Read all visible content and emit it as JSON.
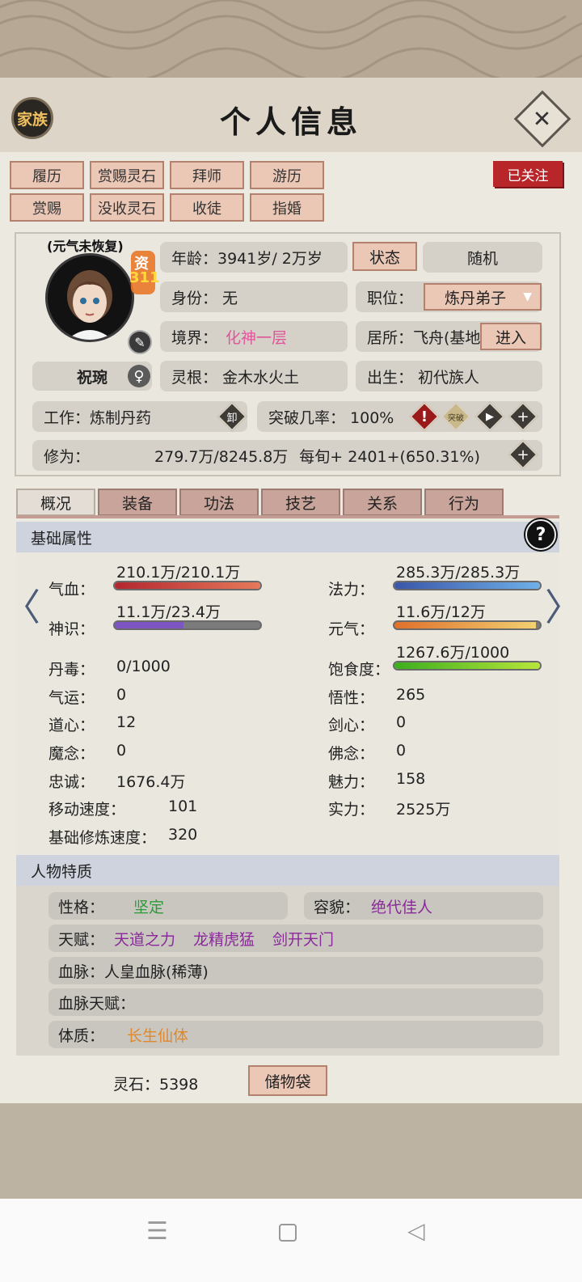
{
  "header": {
    "title": "个人信息",
    "family_label": "家族",
    "close_symbol": "✕",
    "follow_label": "已关注"
  },
  "top_actions": [
    "履历",
    "赏赐灵石",
    "拜师",
    "游历",
    "赏赐",
    "没收灵石",
    "收徒",
    "指婚"
  ],
  "profile": {
    "status_note": "(元气未恢复)",
    "aptitude_label": "资",
    "aptitude_value": "311",
    "name": "祝琬",
    "gender_symbol": "♀",
    "age": "年龄：3941岁/ 2万岁",
    "state_button": "状态",
    "random_button": "随机",
    "identity": "身份：  无",
    "position_label": "职位：",
    "position_value": "炼丹弟子",
    "realm_label": "境界：",
    "realm_value": "化神一层",
    "residence": "居所：飞舟(基地",
    "enter_button": "进入",
    "root": "灵根：  金木水火土",
    "birth": "出生：  初代族人",
    "work": "工作：炼制丹药",
    "unequip_label": "卸",
    "breakthrough": "突破几率：  100%",
    "alert_symbol": "!",
    "breakthrough_icon_label": "突破",
    "cultivation_label": "修为：",
    "cultivation_value": "279.7万/8245.8万",
    "per_period": "每旬+  2401+(650.31%)"
  },
  "tabs": [
    "概况",
    "装备",
    "功法",
    "技艺",
    "关系",
    "行为"
  ],
  "basic": {
    "section_title": "基础属性",
    "help_symbol": "?",
    "hp_label": "气血：",
    "hp_value": "210.1万/210.1万",
    "hp_fraction": 1.0,
    "mana_label": "法力：",
    "mana_value": "285.3万/285.3万",
    "mana_fraction": 1.0,
    "sense_label": "神识：",
    "sense_value": "11.1万/23.4万",
    "sense_fraction": 0.47,
    "vital_label": "元气：",
    "vital_value": "11.6万/12万",
    "vital_fraction": 0.97,
    "satiety_label": "饱食度：",
    "satiety_value": "1267.6万/1000",
    "satiety_fraction": 1.0,
    "stats_left": [
      {
        "label": "丹毒：",
        "value": "0/1000"
      },
      {
        "label": "气运：",
        "value": "0"
      },
      {
        "label": "道心：",
        "value": "12"
      },
      {
        "label": "魔念：",
        "value": "0"
      },
      {
        "label": "忠诚：",
        "value": "1676.4万"
      },
      {
        "label": "移动速度：",
        "value": "101"
      },
      {
        "label": "基础修炼速度：",
        "value": "320"
      }
    ],
    "stats_right": [
      {
        "label": "悟性：",
        "value": "265"
      },
      {
        "label": "剑心：",
        "value": "0"
      },
      {
        "label": "佛念：",
        "value": "0"
      },
      {
        "label": "魅力：",
        "value": "158"
      },
      {
        "label": "实力：",
        "value": "2525万"
      }
    ]
  },
  "traits": {
    "section_title": "人物特质",
    "personality_label": "性格：",
    "personality_value": "坚定",
    "looks_label": "容貌：",
    "looks_value": "绝代佳人",
    "talent_label": "天赋：",
    "talents": [
      "天道之力",
      "龙精虎猛",
      "剑开天门"
    ],
    "bloodline": "血脉：人皇血脉(稀薄)",
    "bloodline_talent": "血脉天赋：",
    "physique_label": "体质：",
    "physique_value": "长生仙体"
  },
  "footer": {
    "spirit_stones": "灵石：5398",
    "bag_button": "储物袋"
  },
  "colors": {
    "pink": "#e0559a",
    "green": "#2f9a3a",
    "purple": "#8a2a9a",
    "orange": "#e0882a",
    "tab_active": "#e4ddd5"
  }
}
